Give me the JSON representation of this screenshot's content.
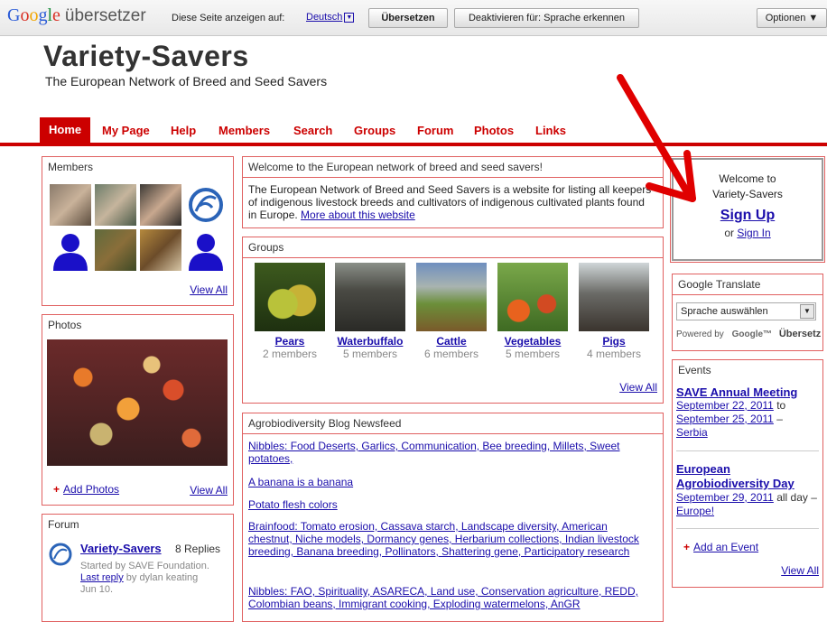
{
  "translate_bar": {
    "logo_google": "Google",
    "logo_product": "übersetzer",
    "view_page_in": "Diese Seite anzeigen auf:",
    "language": "Deutsch",
    "translate_button": "Übersetzen",
    "disable_button": "Deaktivieren für: Sprache erkennen",
    "options_button": "Optionen ▼"
  },
  "site": {
    "title": "Variety-Savers",
    "tagline": "The European Network of Breed and Seed Savers"
  },
  "nav": [
    "Home",
    "My Page",
    "Help",
    "Members",
    "Search",
    "Groups",
    "Forum",
    "Photos",
    "Links"
  ],
  "members": {
    "title": "Members",
    "view_all": "View All"
  },
  "photos": {
    "title": "Photos",
    "add": "Add Photos",
    "view_all": "View All"
  },
  "forum": {
    "title": "Forum",
    "topic": "Variety-Savers",
    "replies": "8 Replies",
    "started": "Started by SAVE Foundation.",
    "last_reply": "Last reply",
    "by": "by dylan keating",
    "date": "Jun 10."
  },
  "welcome_box": {
    "title": "Welcome to the European network of breed and seed savers!",
    "body": "The European Network of Breed and Seed Savers is a website for listing all keepers of indigenous livestock breeds and cultivators of indigenous cultivated plants found in Europe.",
    "more_link": "More about this website"
  },
  "groups": {
    "title": "Groups",
    "view_all": "View All",
    "items": [
      {
        "name": "Pears",
        "members": "2 members"
      },
      {
        "name": "Waterbuffalo",
        "members": "5 members"
      },
      {
        "name": "Cattle",
        "members": "6 members"
      },
      {
        "name": "Vegetables",
        "members": "5 members"
      },
      {
        "name": "Pigs",
        "members": "4 members"
      }
    ]
  },
  "blog": {
    "title": "Agrobiodiversity Blog Newsfeed",
    "items": [
      "Nibbles: Food Deserts, Garlics, Communication, Bee breeding, Millets, Sweet potatoes,",
      "A banana is a banana",
      "Potato flesh colors",
      "Brainfood: Tomato erosion, Cassava starch, Landscape diversity, American chestnut, Niche models, Dormancy genes, Herbarium collections, Indian livestock breeding, Banana breeding, Pollinators, Shattering gene, Participatory research",
      "Nibbles: FAO, Spirituality, ASARECA, Land use, Conservation agriculture, REDD, Colombian beans, Immigrant cooking, Exploding watermelons, AnGR"
    ]
  },
  "signup": {
    "welcome_line1": "Welcome to",
    "welcome_line2": "Variety-Savers",
    "sign_up": "Sign Up",
    "or": "or",
    "sign_in": "Sign In"
  },
  "google_translate_widget": {
    "title": "Google Translate",
    "select": "Sprache auswählen",
    "powered_by": "Powered by",
    "google": "Google™",
    "translate": "Übersetz"
  },
  "events": {
    "title": "Events",
    "items": [
      {
        "name": "SAVE Annual Meeting",
        "date1": "September 22, 2011",
        "to": "to",
        "date2": "September 25, 2011",
        "dash": "–",
        "place": "Serbia"
      },
      {
        "name": "European Agrobiodiversity Day",
        "date1": "September 29, 2011",
        "allday": "all day –",
        "place": "Europe!"
      }
    ],
    "add": "Add an Event",
    "view_all": "View All"
  },
  "colors": {
    "accent": "#cc0000",
    "link": "#1a0dab",
    "arrow": "#e00000"
  }
}
